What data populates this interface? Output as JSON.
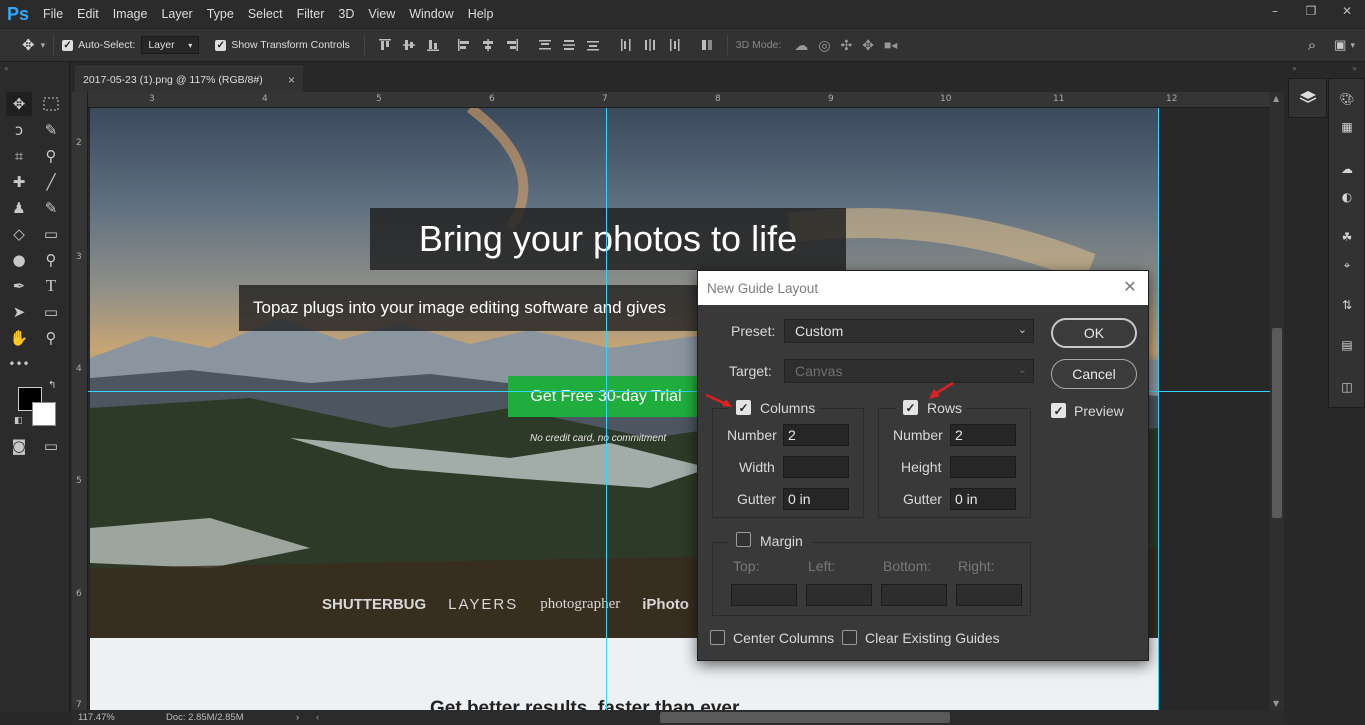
{
  "app": {
    "logo": "Ps",
    "menu": [
      "File",
      "Edit",
      "Image",
      "Layer",
      "Type",
      "Select",
      "Filter",
      "3D",
      "View",
      "Window",
      "Help"
    ],
    "window_controls": [
      "–",
      "❐",
      "✕"
    ]
  },
  "options_bar": {
    "auto_select_label": "Auto-Select:",
    "auto_select_checked": true,
    "auto_select_target": "Layer",
    "show_transform_label": "Show Transform Controls",
    "show_transform_checked": true,
    "mode_3d_label": "3D Mode:"
  },
  "document": {
    "tab_title": "2017-05-23 (1).png @ 117% (RGB/8#)",
    "tab_close": "×",
    "zoom": "117.47%",
    "doc_size": "Doc: 2.85M/2.85M",
    "ruler_h": [
      "3",
      "4",
      "5",
      "6",
      "7",
      "8",
      "9",
      "10",
      "11",
      "12"
    ],
    "ruler_v": [
      "2",
      "3",
      "4",
      "5",
      "6",
      "7"
    ]
  },
  "canvas_content": {
    "headline": "Bring your photos to life",
    "subline": "Topaz plugs into your image editing software and gives",
    "cta": "Get Free 30-day Trial",
    "note": "No credit card, no commitment",
    "brands": [
      "SHUTTERBUG",
      "LAYERS",
      "photographer",
      "iPhoto"
    ],
    "bottom_heading": "Get better results, faster than ever"
  },
  "dialog": {
    "title": "New Guide Layout",
    "close": "✕",
    "preset_label": "Preset:",
    "preset_value": "Custom",
    "target_label": "Target:",
    "target_value": "Canvas",
    "ok": "OK",
    "cancel": "Cancel",
    "preview_label": "Preview",
    "preview_checked": true,
    "columns": {
      "label": "Columns",
      "checked": true,
      "number_label": "Number",
      "number": "2",
      "width_label": "Width",
      "width": "",
      "gutter_label": "Gutter",
      "gutter": "0 in"
    },
    "rows": {
      "label": "Rows",
      "checked": true,
      "number_label": "Number",
      "number": "2",
      "height_label": "Height",
      "height": "",
      "gutter_label": "Gutter",
      "gutter": "0 in"
    },
    "margin": {
      "label": "Margin",
      "checked": false,
      "top_label": "Top:",
      "left_label": "Left:",
      "bottom_label": "Bottom:",
      "right_label": "Right:"
    },
    "center_columns_label": "Center Columns",
    "center_columns_checked": false,
    "clear_guides_label": "Clear Existing Guides",
    "clear_guides_checked": false
  },
  "colors": {
    "guide": "#32d6ff",
    "ps_blue": "#31a8ff",
    "cta_green": "#1fae3e",
    "annotation_arrow": "#e02020"
  }
}
